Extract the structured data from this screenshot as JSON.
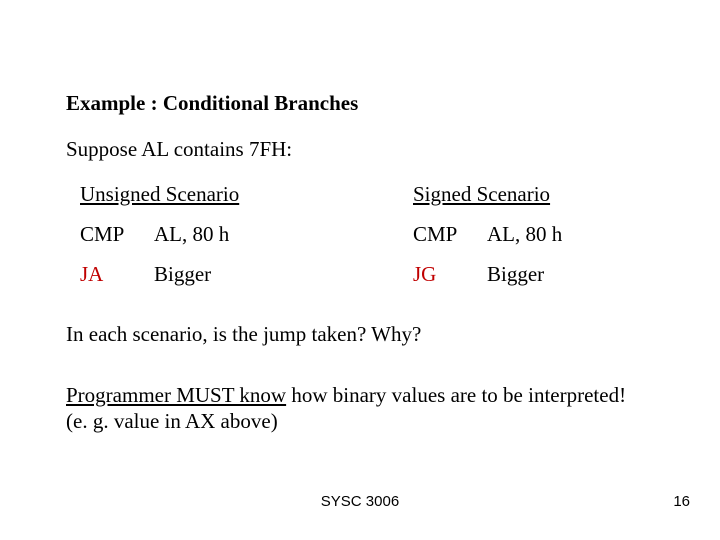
{
  "title": "Example : Conditional Branches",
  "suppose": "Suppose AL contains  7FH:",
  "unsigned": {
    "heading": "Unsigned Scenario",
    "cmp_op": "CMP",
    "cmp_args": "AL,  80 h",
    "jump_op": "JA",
    "jump_target": "Bigger"
  },
  "signed": {
    "heading": "Signed Scenario",
    "cmp_op": "CMP",
    "cmp_args": "AL, 80 h",
    "jump_op": "JG",
    "jump_target": "Bigger"
  },
  "question": "In each scenario, is the jump taken?   Why?",
  "must_underlined": "Programmer MUST know",
  "must_rest1": " how binary values are to be interpreted!",
  "must_rest2": "(e. g. value in AX above)",
  "footer_course": "SYSC 3006",
  "footer_page": "16"
}
